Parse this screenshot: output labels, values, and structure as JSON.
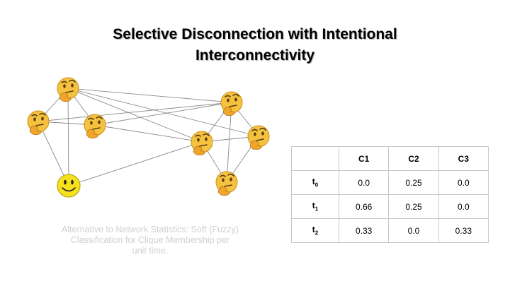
{
  "title": {
    "line1": "Selective Disconnection with Intentional",
    "line2": "Interconnectivity"
  },
  "caption": {
    "line1": "Alternative to Network Statistics: Soft (Fuzzy)",
    "line2": "Classification for Clique Membership per",
    "line3": "unit time."
  },
  "graph": {
    "icons": {
      "thinking": "thinking-face-icon",
      "smiley": "smiley-face-icon"
    },
    "colors": {
      "face_fill": "#f5c240",
      "face_stroke": "#c98e1a",
      "smiley_fill": "#f5e21c",
      "edge": "#8a8a8a"
    }
  },
  "table": {
    "columns": [
      "",
      "C1",
      "C2",
      "C3"
    ],
    "rows": [
      {
        "label": "t",
        "sub": "0",
        "values": [
          "0.0",
          "0.25",
          "0.0"
        ]
      },
      {
        "label": "t",
        "sub": "1",
        "values": [
          "0.66",
          "0.25",
          "0.0"
        ]
      },
      {
        "label": "t",
        "sub": "2",
        "values": [
          "0.33",
          "0.0",
          "0.33"
        ]
      }
    ]
  }
}
